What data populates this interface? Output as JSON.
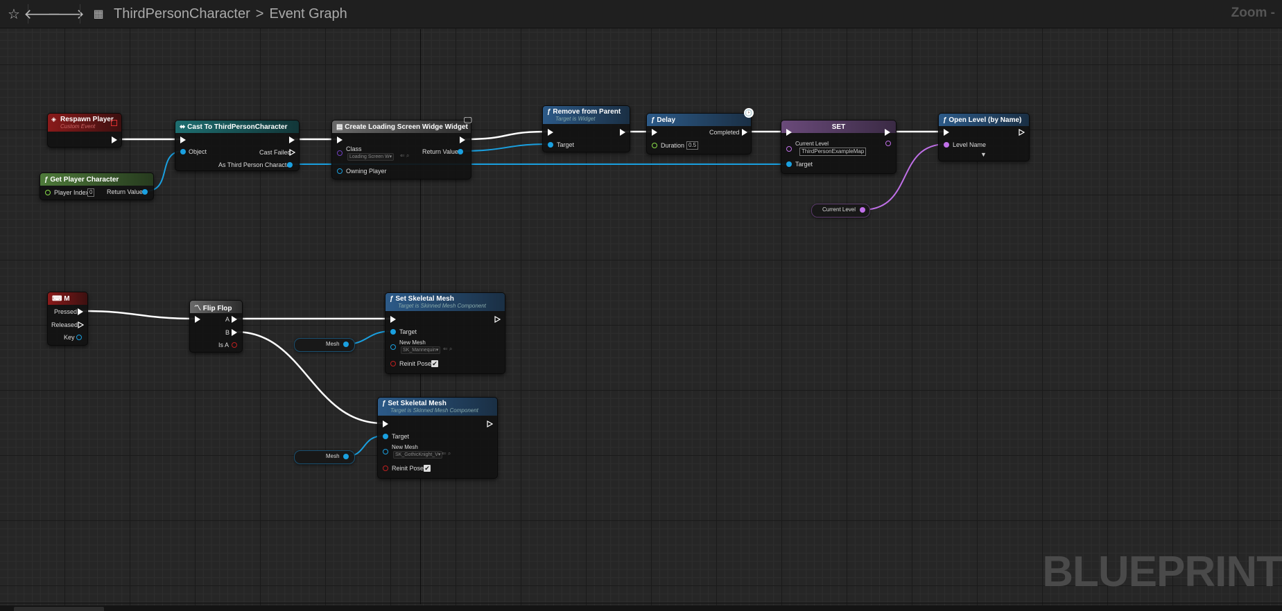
{
  "breadcrumb": {
    "class": "ThirdPersonCharacter",
    "graph": "Event Graph"
  },
  "zoom_label": "Zoom -",
  "watermark": "BLUEPRINT",
  "nodes": {
    "respawn": {
      "title": "Respawn Player",
      "subtitle": "Custom Event"
    },
    "get_player": {
      "title": "Get Player Character",
      "player_index_label": "Player Index",
      "player_index_value": "0",
      "return_label": "Return Value"
    },
    "cast": {
      "title": "Cast To ThirdPersonCharacter",
      "object_label": "Object",
      "cast_failed_label": "Cast Failed",
      "as_label": "As Third Person Character"
    },
    "create_widget": {
      "title": "Create Loading Screen Widge Widget",
      "class_label": "Class",
      "class_value": "Loading Screen W▾",
      "return_label": "Return Value",
      "owning_label": "Owning Player"
    },
    "remove": {
      "title": "Remove from Parent",
      "subtitle": "Target is Widget",
      "target_label": "Target"
    },
    "delay": {
      "title": "Delay",
      "completed_label": "Completed",
      "duration_label": "Duration",
      "duration_value": "0.5"
    },
    "set": {
      "title": "SET",
      "current_level_label": "Current Level",
      "current_level_value": "ThirdPersonExampleMap",
      "target_label": "Target"
    },
    "open_level": {
      "title": "Open Level (by Name)",
      "level_name_label": "Level Name"
    },
    "current_level_var": {
      "label": "Current Level"
    },
    "key_m": {
      "title": "M",
      "pressed_label": "Pressed",
      "released_label": "Released",
      "key_label": "Key"
    },
    "flipflop": {
      "title": "Flip Flop",
      "a_label": "A",
      "b_label": "B",
      "isa_label": "Is A"
    },
    "set_mesh_1": {
      "title": "Set Skeletal Mesh",
      "subtitle": "Target is Skinned Mesh Component",
      "target_label": "Target",
      "new_mesh_label": "New Mesh",
      "new_mesh_value": "SK_Mannequin▾",
      "reinit_label": "Reinit Pose",
      "reinit_checked": "✔"
    },
    "set_mesh_2": {
      "title": "Set Skeletal Mesh",
      "subtitle": "Target is Skinned Mesh Component",
      "target_label": "Target",
      "new_mesh_label": "New Mesh",
      "new_mesh_value": "SK_GothicKnight_V▾",
      "reinit_label": "Reinit Pose",
      "reinit_checked": "✔"
    },
    "mesh_var_1": {
      "label": "Mesh"
    },
    "mesh_var_2": {
      "label": "Mesh"
    }
  },
  "colors": {
    "exec_wire": "#ffffff",
    "object_wire": "#1aa0e0",
    "string_wire": "#c070e8"
  }
}
